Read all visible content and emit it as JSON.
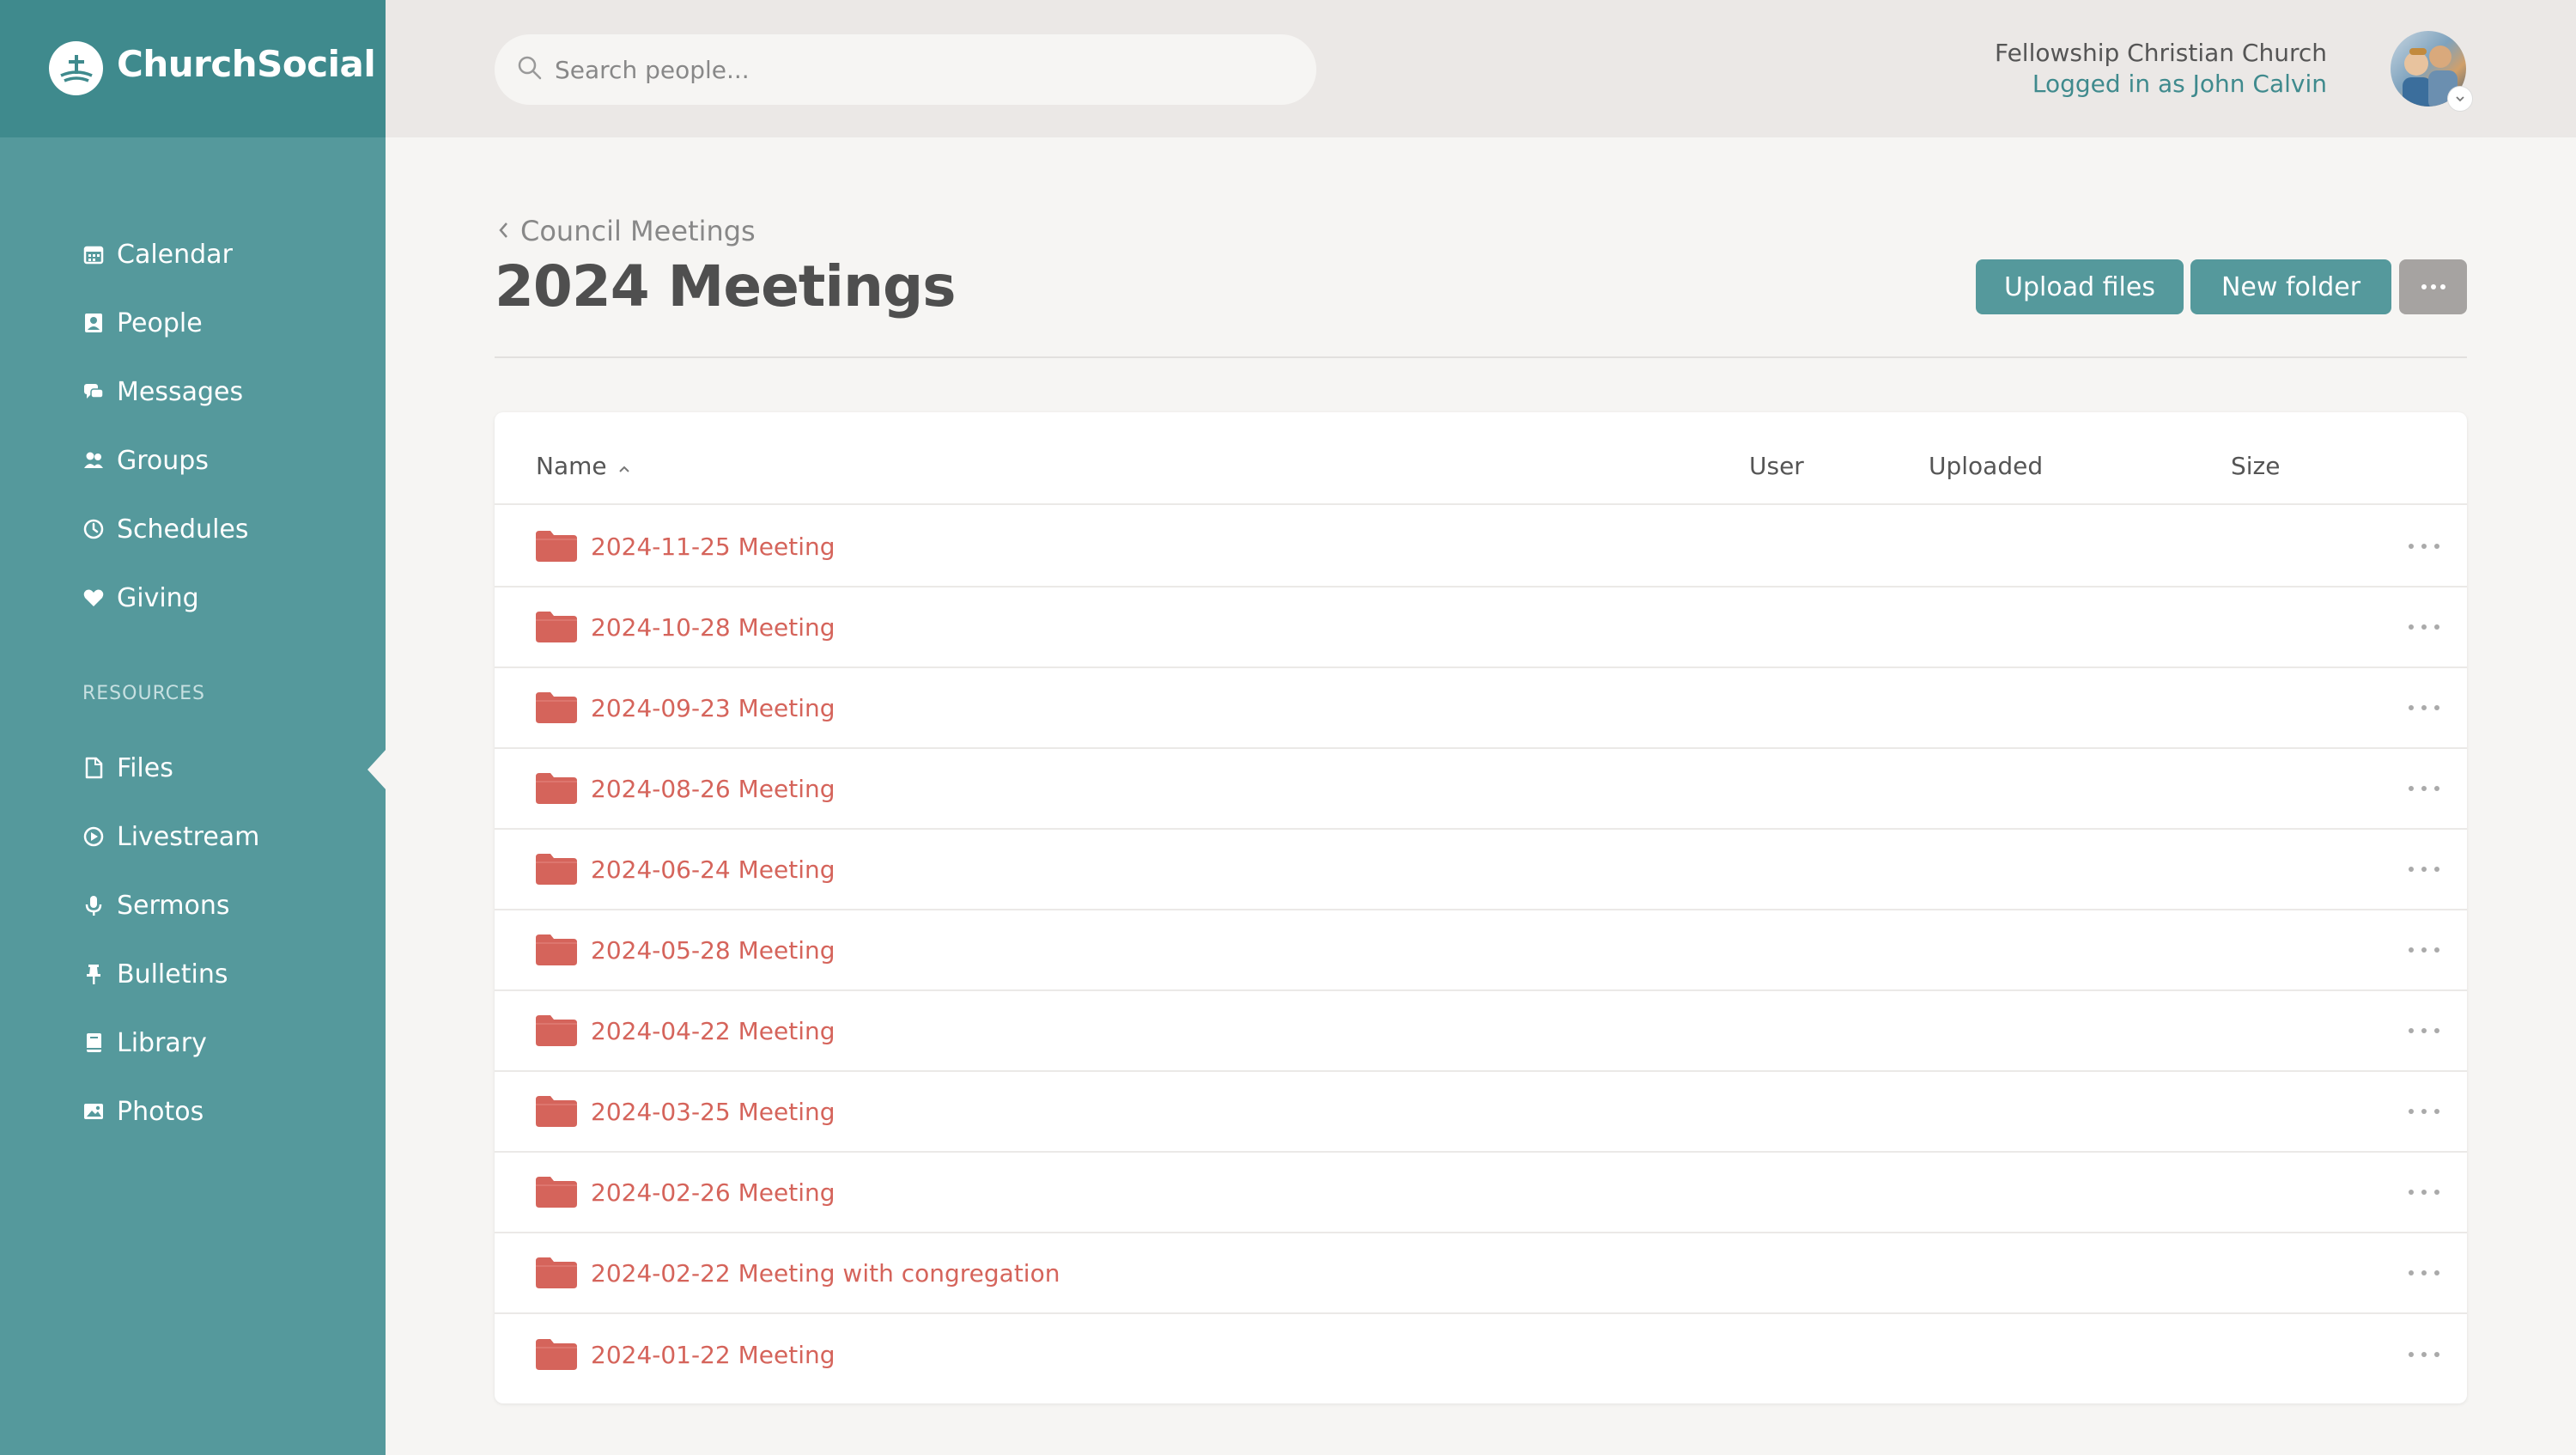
{
  "app": {
    "brand": "ChurchSocial"
  },
  "search": {
    "placeholder": "Search people..."
  },
  "account": {
    "org_name": "Fellowship Christian Church",
    "login_text": "Logged in as John Calvin"
  },
  "sidebar": {
    "main_items": [
      {
        "label": "Calendar",
        "icon": "calendar-icon"
      },
      {
        "label": "People",
        "icon": "people-icon"
      },
      {
        "label": "Messages",
        "icon": "messages-icon"
      },
      {
        "label": "Groups",
        "icon": "groups-icon"
      },
      {
        "label": "Schedules",
        "icon": "clock-icon"
      },
      {
        "label": "Giving",
        "icon": "heart-icon"
      }
    ],
    "section_label": "RESOURCES",
    "resource_items": [
      {
        "label": "Files",
        "icon": "file-icon",
        "active": true
      },
      {
        "label": "Livestream",
        "icon": "play-icon"
      },
      {
        "label": "Sermons",
        "icon": "microphone-icon"
      },
      {
        "label": "Bulletins",
        "icon": "pin-icon"
      },
      {
        "label": "Library",
        "icon": "book-icon"
      },
      {
        "label": "Photos",
        "icon": "photo-icon"
      }
    ]
  },
  "page": {
    "back_label": "Council Meetings",
    "title": "2024 Meetings",
    "upload_label": "Upload files",
    "new_folder_label": "New folder",
    "more_label": "•••"
  },
  "table": {
    "columns": [
      "Name",
      "User",
      "Uploaded",
      "Size"
    ],
    "sort": "name-ascending",
    "rows": [
      {
        "name": "2024-11-25 Meeting",
        "type": "folder"
      },
      {
        "name": "2024-10-28 Meeting",
        "type": "folder"
      },
      {
        "name": "2024-09-23 Meeting",
        "type": "folder"
      },
      {
        "name": "2024-08-26 Meeting",
        "type": "folder"
      },
      {
        "name": "2024-06-24 Meeting",
        "type": "folder"
      },
      {
        "name": "2024-05-28 Meeting",
        "type": "folder"
      },
      {
        "name": "2024-04-22 Meeting",
        "type": "folder"
      },
      {
        "name": "2024-03-25 Meeting",
        "type": "folder"
      },
      {
        "name": "2024-02-26 Meeting",
        "type": "folder"
      },
      {
        "name": "2024-02-22 Meeting with congregation",
        "type": "folder"
      },
      {
        "name": "2024-01-22 Meeting",
        "type": "folder"
      }
    ]
  },
  "colors": {
    "sidebar": "#55999c",
    "brand_bar": "#3f8a8d",
    "accent": "#55999c",
    "folder": "#d5645b",
    "secondary_button": "#a6a3a1"
  }
}
